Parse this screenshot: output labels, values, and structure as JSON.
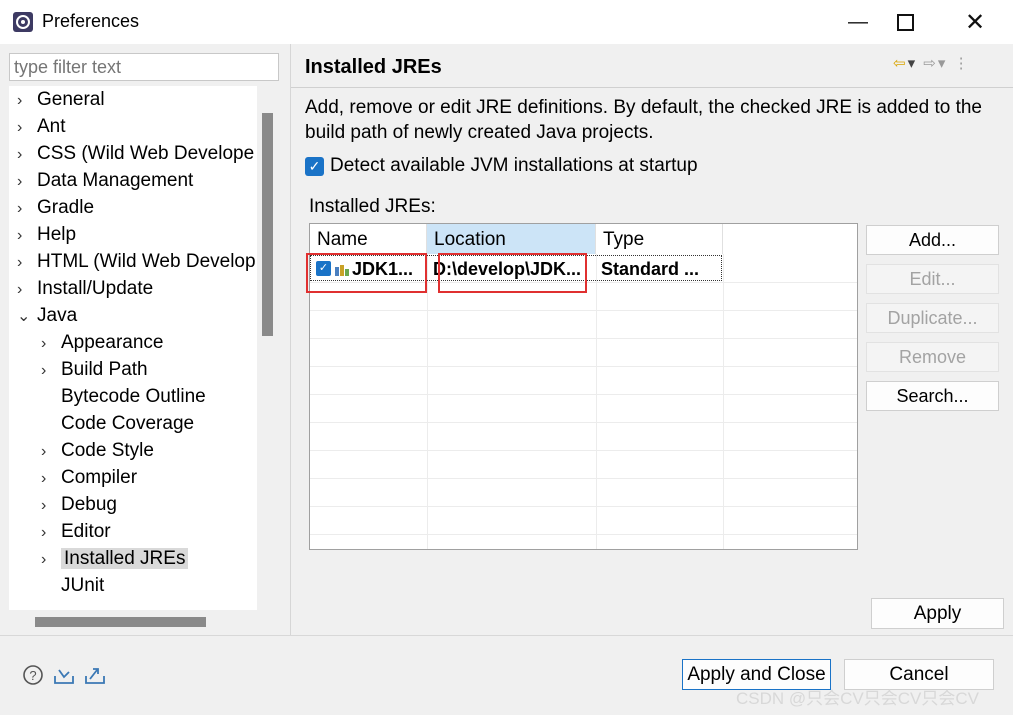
{
  "window": {
    "title": "Preferences"
  },
  "filter": {
    "placeholder": "type filter text"
  },
  "tree": {
    "items": [
      {
        "label": "General",
        "expandable": true,
        "depth": 0
      },
      {
        "label": "Ant",
        "expandable": true,
        "depth": 0
      },
      {
        "label": "CSS (Wild Web Develope",
        "expandable": true,
        "depth": 0
      },
      {
        "label": "Data Management",
        "expandable": true,
        "depth": 0
      },
      {
        "label": "Gradle",
        "expandable": true,
        "depth": 0
      },
      {
        "label": "Help",
        "expandable": true,
        "depth": 0
      },
      {
        "label": "HTML (Wild Web Develop",
        "expandable": true,
        "depth": 0
      },
      {
        "label": "Install/Update",
        "expandable": true,
        "depth": 0
      },
      {
        "label": "Java",
        "expandable": true,
        "expanded": true,
        "depth": 0
      },
      {
        "label": "Appearance",
        "expandable": true,
        "depth": 1
      },
      {
        "label": "Build Path",
        "expandable": true,
        "depth": 1
      },
      {
        "label": "Bytecode Outline",
        "expandable": false,
        "depth": 1
      },
      {
        "label": "Code Coverage",
        "expandable": false,
        "depth": 1
      },
      {
        "label": "Code Style",
        "expandable": true,
        "depth": 1
      },
      {
        "label": "Compiler",
        "expandable": true,
        "depth": 1
      },
      {
        "label": "Debug",
        "expandable": true,
        "depth": 1
      },
      {
        "label": "Editor",
        "expandable": true,
        "depth": 1
      },
      {
        "label": "Installed JREs",
        "expandable": true,
        "depth": 1,
        "selected": true
      },
      {
        "label": "JUnit",
        "expandable": false,
        "depth": 1
      }
    ]
  },
  "page": {
    "title": "Installed JREs",
    "description_line1": "Add, remove or edit JRE definitions. By default, the checked JRE is added to the",
    "description_line2": "build path of newly created Java projects.",
    "detect_label": "Detect available JVM installations at startup",
    "detect_checked": true,
    "table_label": "Installed JREs:"
  },
  "table": {
    "columns": [
      "Name",
      "Location",
      "Type"
    ],
    "rows": [
      {
        "checked": true,
        "name": "JDK1...",
        "location": "D:\\develop\\JDK...",
        "type": "Standard ..."
      }
    ]
  },
  "side_buttons": {
    "add": "Add...",
    "edit": "Edit...",
    "duplicate": "Duplicate...",
    "remove": "Remove",
    "search": "Search..."
  },
  "footer": {
    "apply": "Apply",
    "apply_close": "Apply and Close",
    "cancel": "Cancel"
  },
  "watermark": "CSDN @只会CV只会CV只会CV",
  "colors": {
    "accent": "#1a73c7",
    "highlight_box": "#e03030",
    "selection": "#d9d9d9"
  }
}
